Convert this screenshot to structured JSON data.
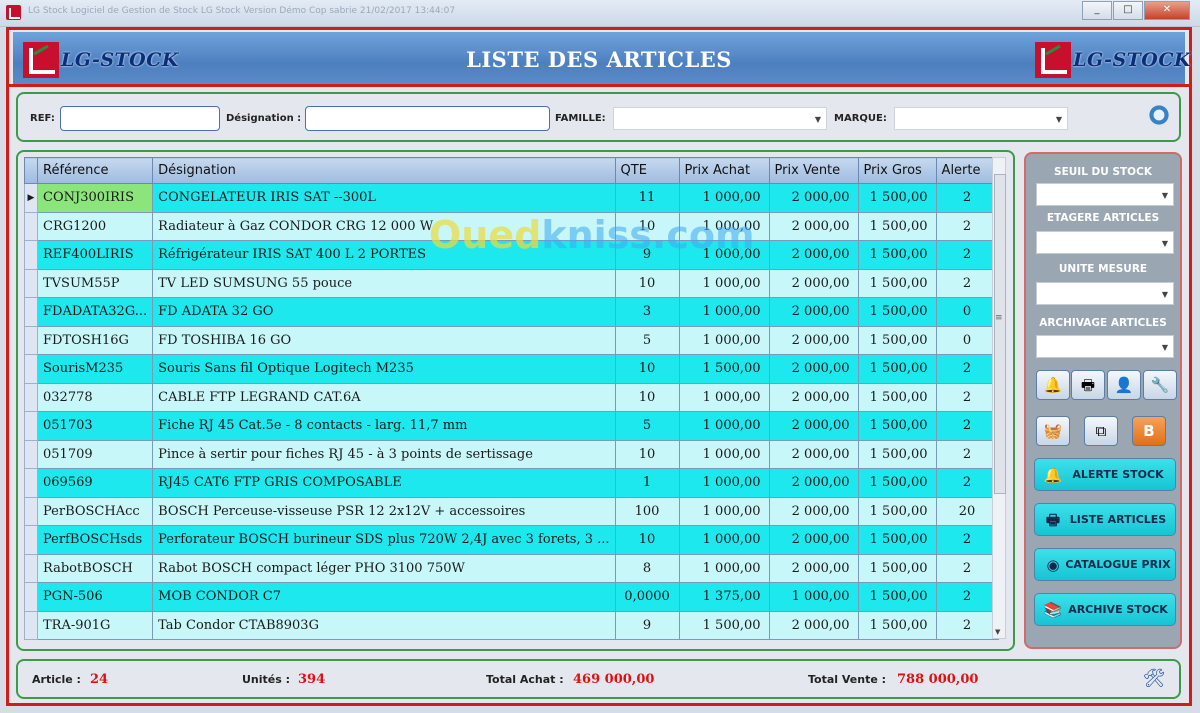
{
  "window": {
    "title": "LG Stock Logiciel de Gestion de Stock   LG Stock   Version Démo     Cop sabrie      21/02/2017 13:44:07",
    "buttons": [
      "_",
      "□",
      "✕"
    ]
  },
  "header": {
    "title": "LISTE  DES ARTICLES",
    "logo_text": "LG-STOCK"
  },
  "filters": {
    "ref_label": "REF:",
    "ref_value": "",
    "designation_label": "Désignation :",
    "designation_value": "",
    "famille_label": "FAMILLE:",
    "famille_value": "",
    "marque_label": "MARQUE:",
    "marque_value": ""
  },
  "table": {
    "columns": [
      "Référence",
      "Désignation",
      "QTE",
      "Prix Achat",
      "Prix Vente",
      "Prix Gros",
      "Alerte"
    ],
    "rows": [
      [
        "CONJ300IRIS",
        "CONGELATEUR IRIS SAT --300L",
        "11",
        "1 000,00",
        "2 000,00",
        "1 500,00",
        "2"
      ],
      [
        "CRG1200",
        "Radiateur à Gaz CONDOR CRG 12 000 W",
        "10",
        "1 000,00",
        "2 000,00",
        "1 500,00",
        "2"
      ],
      [
        "REF400LIRIS",
        "Réfrigérateur IRIS SAT 400 L 2 PORTES",
        "9",
        "1 000,00",
        "2 000,00",
        "1 500,00",
        "2"
      ],
      [
        "TVSUM55P",
        "TV LED SUMSUNG 55 pouce",
        "10",
        "1 000,00",
        "2 000,00",
        "1 500,00",
        "2"
      ],
      [
        "FDADATA32G...",
        "FD ADATA 32 GO",
        "3",
        "1 000,00",
        "2 000,00",
        "1 500,00",
        "0"
      ],
      [
        "FDTOSH16G",
        "FD TOSHIBA 16 GO",
        "5",
        "1 000,00",
        "2 000,00",
        "1 500,00",
        "0"
      ],
      [
        "SourisM235",
        "Souris Sans fil Optique Logitech M235",
        "10",
        "1 500,00",
        "2 000,00",
        "1 500,00",
        "2"
      ],
      [
        "032778",
        "CABLE FTP  LEGRAND CAT.6A",
        "10",
        "1 000,00",
        "2 000,00",
        "1 500,00",
        "2"
      ],
      [
        "051703",
        "Fiche RJ 45 Cat.5e - 8 contacts - larg. 11,7 mm",
        "5",
        "1 000,00",
        "2 000,00",
        "1 500,00",
        "2"
      ],
      [
        "051709",
        "Pince à sertir pour fiches RJ 45 - à 3 points de sertissage",
        "10",
        "1 000,00",
        "2 000,00",
        "1 500,00",
        "2"
      ],
      [
        "069569",
        "RJ45 CAT6 FTP GRIS COMPOSABLE",
        "1",
        "1 000,00",
        "2 000,00",
        "1 500,00",
        "2"
      ],
      [
        "PerBOSCHAcc",
        "BOSCH Perceuse-visseuse PSR 12 2x12V + accessoires",
        "100",
        "1 000,00",
        "2 000,00",
        "1 500,00",
        "20"
      ],
      [
        "PerfBOSCHsds",
        "Perforateur BOSCH  burineur SDS plus 720W 2,4J avec 3 forets, 3 ...",
        "10",
        "1 000,00",
        "2 000,00",
        "1 500,00",
        "2"
      ],
      [
        "RabotBOSCH",
        "Rabot BOSCH  compact léger PHO 3100 750W",
        "8",
        "1 000,00",
        "2 000,00",
        "1 500,00",
        "2"
      ],
      [
        "PGN-506",
        "MOB CONDOR C7",
        "0,0000",
        "1 375,00",
        "1 000,00",
        "1 500,00",
        "2"
      ],
      [
        "TRA-901G",
        "Tab Condor  CTAB8903G",
        "9",
        "1 500,00",
        "2 000,00",
        "1 500,00",
        "2"
      ]
    ]
  },
  "watermark": {
    "part1": "Oued",
    "part2": "kniss.com"
  },
  "side_panel": {
    "seuil_label": "SEUIL DU STOCK",
    "etagere_label": "ETAGERE ARTICLES",
    "unite_label": "UNITE MESURE",
    "archivage_label": "ARCHIVAGE ARTICLES",
    "alerte_button": "ALERTE   STOCK",
    "liste_button": "LISTE   ARTICLES",
    "catalogue_button": "CATALOGUE PRIX",
    "archive_button": "ARCHIVE STOCK"
  },
  "footer": {
    "article_label": "Article :",
    "article_value": "24",
    "unites_label": "Unités :",
    "unites_value": "394",
    "total_achat_label": "Total Achat :",
    "total_achat_value": "469 000,00",
    "total_vente_label": "Total Vente :",
    "total_vente_value": "788 000,00"
  },
  "colors": {
    "accent": "#d21c1c",
    "row_cyan": "#1ce8ee",
    "row_light": "#c8f7fa",
    "value_red": "#dd1111"
  }
}
